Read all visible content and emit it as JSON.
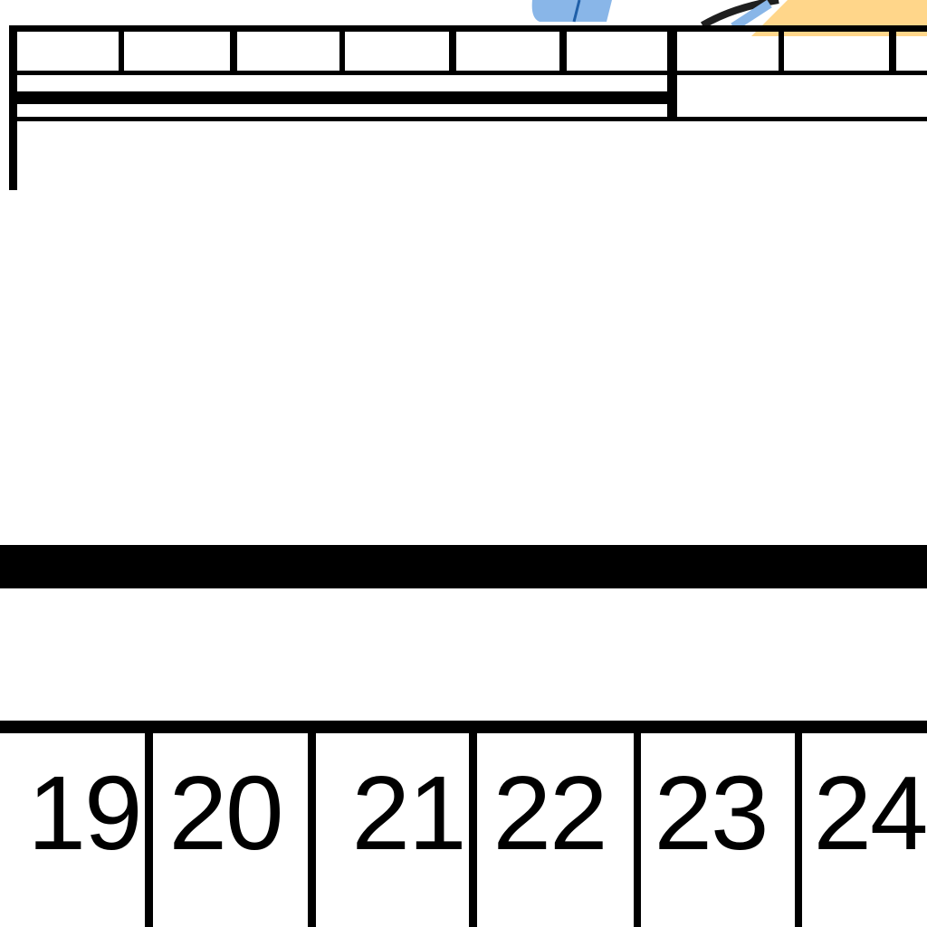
{
  "timeline": {
    "numbers": [
      "19",
      "20",
      "21",
      "22",
      "23",
      "24"
    ]
  },
  "colors": {
    "line": "#000000",
    "blue_marker": "#89b6e8",
    "orange_marker": "#ffd68a"
  },
  "icons": [
    "blue-shape-icon",
    "orange-shape-icon"
  ]
}
